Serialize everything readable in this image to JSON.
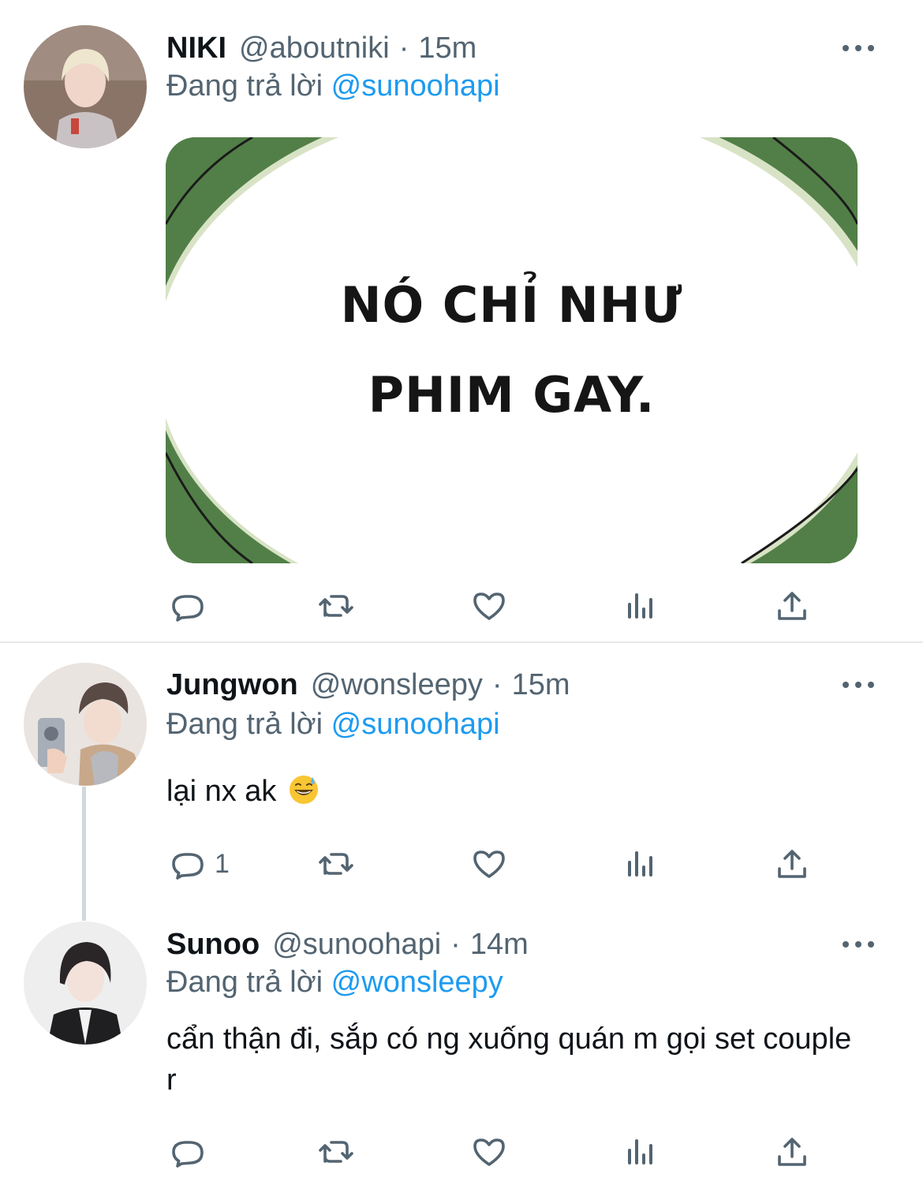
{
  "tweets": [
    {
      "name": "NIKI",
      "handle": "@aboutniki",
      "time": "15m",
      "replying_prefix": "Đang trả lời",
      "replying_to": "@sunoohapi",
      "text": "",
      "media_caption_line1": "NÓ CHỈ NHƯ",
      "media_caption_line2": "PHIM GAY.",
      "reply_count": ""
    },
    {
      "name": "Jungwon",
      "handle": "@wonsleepy",
      "time": "15m",
      "replying_prefix": "Đang trả lời",
      "replying_to": "@sunoohapi",
      "text": "lại nx ak",
      "emoji": "grinning-face-with-sweat",
      "reply_count": "1"
    },
    {
      "name": "Sunoo",
      "handle": "@sunoohapi",
      "time": "14m",
      "replying_prefix": "Đang trả lời",
      "replying_to": "@wonsleepy",
      "text": "cẩn thận đi, sắp có ng xuống quán m gọi set couple r",
      "reply_count": ""
    }
  ],
  "separator": "·",
  "icons": [
    "reply-icon",
    "retweet-icon",
    "like-icon",
    "analytics-icon",
    "share-icon",
    "more-icon"
  ],
  "colors": {
    "link": "#1d9bf0",
    "secondary": "#536471",
    "text": "#0f1419"
  }
}
